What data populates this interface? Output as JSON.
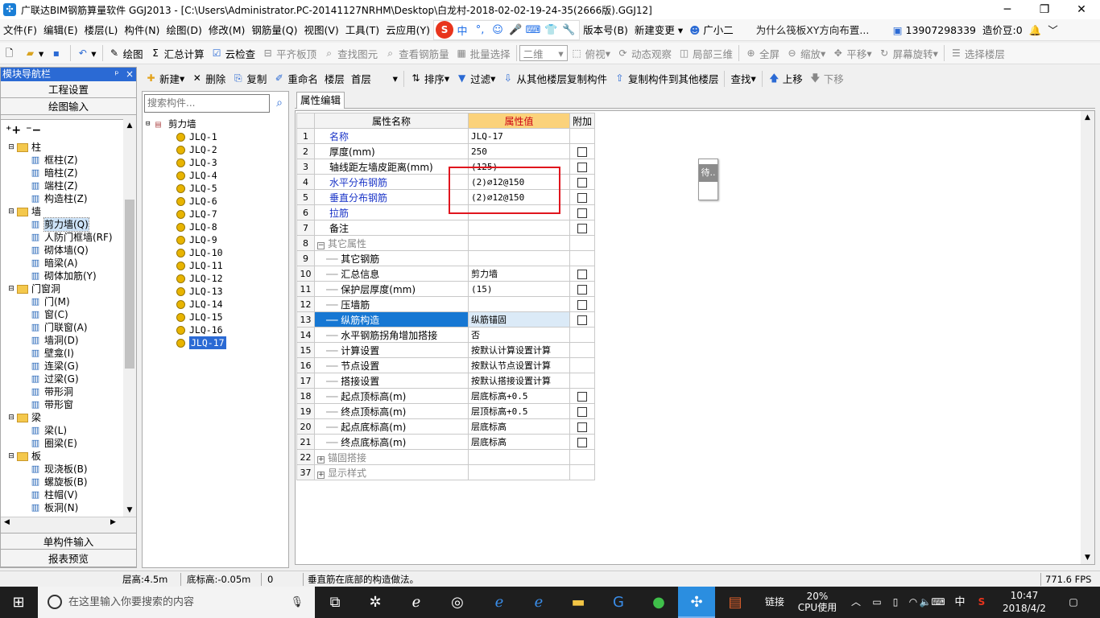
{
  "window": {
    "title": "广联达BIM钢筋算量软件 GGJ2013 - [C:\\Users\\Administrator.PC-20141127NRHM\\Desktop\\白龙村-2018-02-02-19-24-35(2666版).GGJ12]",
    "minimize": "─",
    "maximize": "❐",
    "close": "✕"
  },
  "menu": {
    "items": [
      "文件(F)",
      "编辑(E)",
      "楼层(L)",
      "构件(N)",
      "绘图(D)",
      "修改(M)",
      "钢筋量(Q)",
      "视图(V)",
      "工具(T)",
      "云应用(Y)"
    ],
    "ime": [
      "中",
      "°,",
      "☺",
      "🎤",
      "⌨",
      "👕",
      "🔧"
    ],
    "version": "版本号(B)",
    "new_change": "新建变更",
    "assistant": "广小二",
    "promo": "为什么筏板XY方向布置...",
    "phone": "13907298339",
    "price": "造价豆:0"
  },
  "toolbar1": {
    "draw": "绘图",
    "sum": "汇总计算",
    "cloud_check": "云检查",
    "align_top": "平齐板顶",
    "find_elem": "查找图元",
    "view_rebar": "查看钢筋量",
    "batch_select": "批量选择",
    "view_mode": "二维",
    "top_view": "俯视",
    "dynamic": "动态观察",
    "local_3d": "局部三维",
    "fullscreen": "全屏",
    "zoom": "缩放",
    "pan": "平移",
    "rotate": "屏幕旋转",
    "select_floor": "选择楼层"
  },
  "toolbar2": {
    "new": "新建",
    "delete": "删除",
    "copy": "复制",
    "rename": "重命名",
    "floor_label": "楼层",
    "floor_value": "首层",
    "sort": "排序",
    "filter": "过滤",
    "copy_from": "从其他楼层复制构件",
    "copy_to": "复制构件到其他楼层",
    "find": "查找",
    "move_up": "上移",
    "move_down": "下移"
  },
  "nav": {
    "header": "模块导航栏",
    "pin": "ᵖ",
    "close": "×",
    "project_settings": "工程设置",
    "drawing_input": "绘图输入",
    "single_input": "单构件输入",
    "report_preview": "报表预览",
    "tree": [
      {
        "label": "柱",
        "type": "folder"
      },
      {
        "label": "框柱(Z)",
        "type": "item"
      },
      {
        "label": "暗柱(Z)",
        "type": "item"
      },
      {
        "label": "端柱(Z)",
        "type": "item"
      },
      {
        "label": "构造柱(Z)",
        "type": "item"
      },
      {
        "label": "墙",
        "type": "folder"
      },
      {
        "label": "剪力墙(Q)",
        "type": "item",
        "selected": true
      },
      {
        "label": "人防门框墙(RF)",
        "type": "item"
      },
      {
        "label": "砌体墙(Q)",
        "type": "item"
      },
      {
        "label": "暗梁(A)",
        "type": "item"
      },
      {
        "label": "砌体加筋(Y)",
        "type": "item"
      },
      {
        "label": "门窗洞",
        "type": "folder"
      },
      {
        "label": "门(M)",
        "type": "item"
      },
      {
        "label": "窗(C)",
        "type": "item"
      },
      {
        "label": "门联窗(A)",
        "type": "item"
      },
      {
        "label": "墙洞(D)",
        "type": "item"
      },
      {
        "label": "壁龛(I)",
        "type": "item"
      },
      {
        "label": "连梁(G)",
        "type": "item"
      },
      {
        "label": "过梁(G)",
        "type": "item"
      },
      {
        "label": "带形洞",
        "type": "item"
      },
      {
        "label": "带形窗",
        "type": "item"
      },
      {
        "label": "梁",
        "type": "folder"
      },
      {
        "label": "梁(L)",
        "type": "item"
      },
      {
        "label": "圈梁(E)",
        "type": "item"
      },
      {
        "label": "板",
        "type": "folder"
      },
      {
        "label": "现浇板(B)",
        "type": "item"
      },
      {
        "label": "螺旋板(B)",
        "type": "item"
      },
      {
        "label": "柱帽(V)",
        "type": "item"
      },
      {
        "label": "板洞(N)",
        "type": "item"
      }
    ]
  },
  "components": {
    "search_placeholder": "搜索构件...",
    "root": "剪力墙",
    "items": [
      "JLQ-1",
      "JLQ-2",
      "JLQ-3",
      "JLQ-4",
      "JLQ-5",
      "JLQ-6",
      "JLQ-7",
      "JLQ-8",
      "JLQ-9",
      "JLQ-10",
      "JLQ-11",
      "JLQ-12",
      "JLQ-13",
      "JLQ-14",
      "JLQ-15",
      "JLQ-16",
      "JLQ-17"
    ],
    "selected_index": 16
  },
  "props": {
    "tab": "属性编辑",
    "col_name": "属性名称",
    "col_value": "属性值",
    "col_add": "附加",
    "rows": [
      {
        "n": "1",
        "name": "名称",
        "value": "JLQ-17",
        "cb": false,
        "style": "blue"
      },
      {
        "n": "2",
        "name": "厚度(mm)",
        "value": "250",
        "cb": true
      },
      {
        "n": "3",
        "name": "轴线距左墙皮距离(mm)",
        "value": "(125)",
        "cb": true
      },
      {
        "n": "4",
        "name": "水平分布钢筋",
        "value": "(2)⌀12@150",
        "cb": true,
        "style": "blue"
      },
      {
        "n": "5",
        "name": "垂直分布钢筋",
        "value": "(2)⌀12@150",
        "cb": true,
        "style": "blue"
      },
      {
        "n": "6",
        "name": "拉筋",
        "value": "",
        "cb": true,
        "style": "blue"
      },
      {
        "n": "7",
        "name": "备注",
        "value": "",
        "cb": true
      },
      {
        "n": "8",
        "name": "其它属性",
        "value": "",
        "cb": false,
        "style": "gray",
        "group": "−"
      },
      {
        "n": "9",
        "name": "其它钢筋",
        "value": "",
        "cb": false,
        "indent": true
      },
      {
        "n": "10",
        "name": "汇总信息",
        "value": "剪力墙",
        "cb": true,
        "indent": true
      },
      {
        "n": "11",
        "name": "保护层厚度(mm)",
        "value": "(15)",
        "cb": true,
        "indent": true
      },
      {
        "n": "12",
        "name": "压墙筋",
        "value": "",
        "cb": true,
        "indent": true
      },
      {
        "n": "13",
        "name": "纵筋构造",
        "value": "纵筋锚固",
        "cb": true,
        "indent": true,
        "selected": true
      },
      {
        "n": "14",
        "name": "水平钢筋拐角增加搭接",
        "value": "否",
        "cb": false,
        "indent": true
      },
      {
        "n": "15",
        "name": "计算设置",
        "value": "按默认计算设置计算",
        "cb": false,
        "indent": true
      },
      {
        "n": "16",
        "name": "节点设置",
        "value": "按默认节点设置计算",
        "cb": false,
        "indent": true
      },
      {
        "n": "17",
        "name": "搭接设置",
        "value": "按默认搭接设置计算",
        "cb": false,
        "indent": true
      },
      {
        "n": "18",
        "name": "起点顶标高(m)",
        "value": "层底标高+0.5",
        "cb": true,
        "indent": true
      },
      {
        "n": "19",
        "name": "终点顶标高(m)",
        "value": "层顶标高+0.5",
        "cb": true,
        "indent": true
      },
      {
        "n": "20",
        "name": "起点底标高(m)",
        "value": "层底标高",
        "cb": true,
        "indent": true
      },
      {
        "n": "21",
        "name": "终点底标高(m)",
        "value": "层底标高",
        "cb": true,
        "indent": true
      },
      {
        "n": "22",
        "name": "锚固搭接",
        "value": "",
        "cb": false,
        "style": "gray",
        "group": "+"
      },
      {
        "n": "37",
        "name": "显示样式",
        "value": "",
        "cb": false,
        "style": "gray",
        "group": "+"
      }
    ]
  },
  "tooltip": {
    "text": "待.."
  },
  "status": {
    "floor_height": "层高:4.5m",
    "bottom_elev": "底标高:-0.05m",
    "zero": "0",
    "hint": "垂直筋在底部的构造做法。",
    "fps": "771.6 FPS"
  },
  "taskbar": {
    "search_placeholder": "在这里输入你要搜索的内容",
    "links": "链接",
    "cpu_percent": "20%",
    "cpu_label": "CPU使用",
    "ime": "中",
    "time": "10:47",
    "date": "2018/4/2"
  },
  "colors": {
    "accent": "#2b6ad4",
    "highlight_box": "#e0151e",
    "selected_row": "#1677d3",
    "value_header": "#fbd27b"
  }
}
